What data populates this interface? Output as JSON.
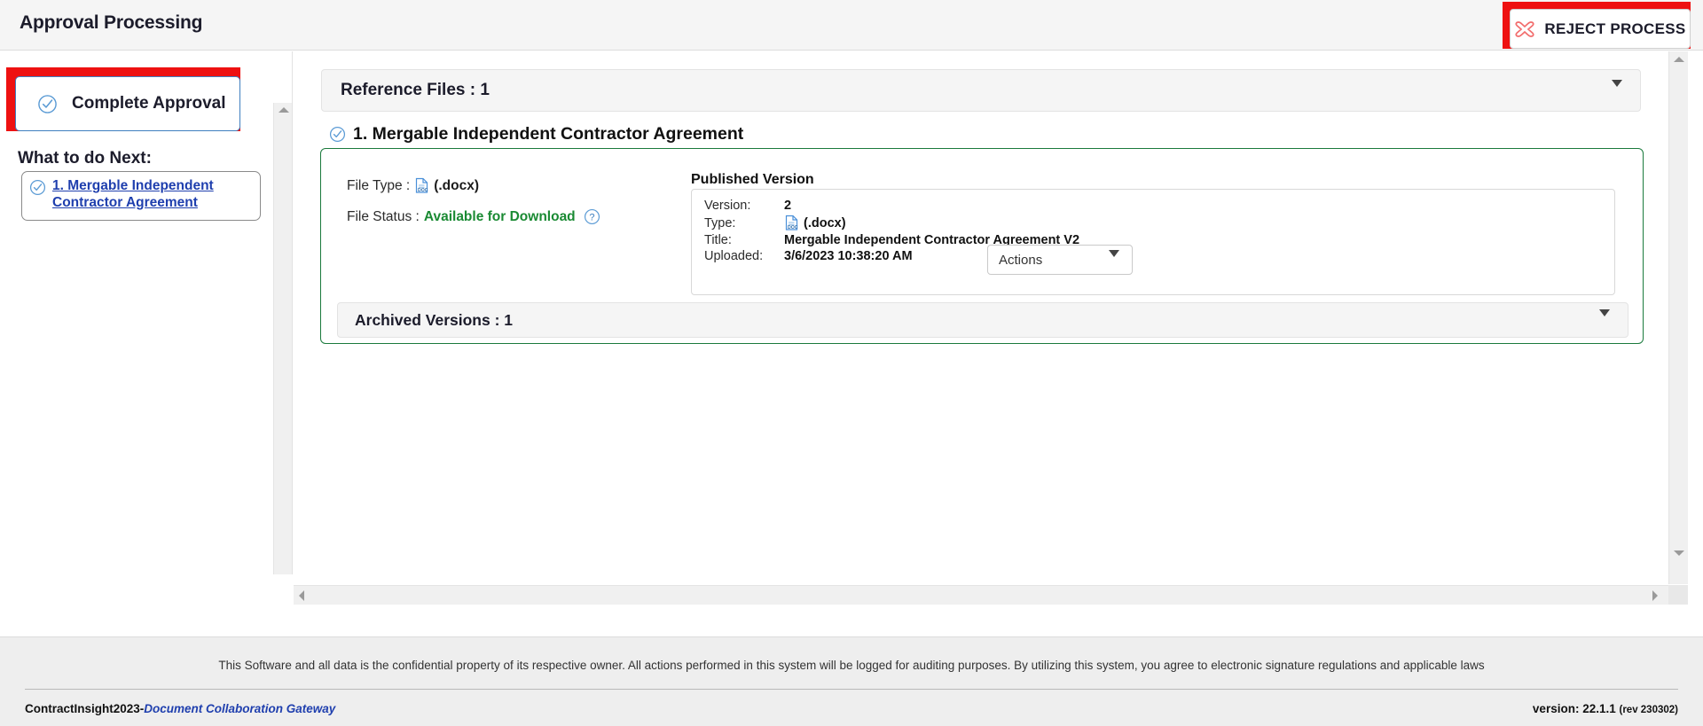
{
  "header": {
    "title": "Approval Processing",
    "reject_button": {
      "label": "REJECT PROCESS",
      "icon": "reject-x-icon",
      "highlight_color": "#ee1111"
    }
  },
  "left_panel": {
    "complete_approval": {
      "label": "Complete Approval",
      "icon": "check-circle-icon",
      "highlight_color": "#ee1111"
    },
    "what_to_do_next": {
      "title": "What to do Next:",
      "items": [
        {
          "icon": "check-circle-icon",
          "label": "1. Mergable Independent Contractor Agreement"
        }
      ]
    },
    "scrollbar": {
      "up_icon": "triangle-up-icon",
      "down_icon": "triangle-down-icon"
    }
  },
  "main": {
    "reference_files": {
      "label": "Reference Files : 1",
      "caret_icon": "chevron-down-icon"
    },
    "document": {
      "heading": "1. Mergable Independent Contractor Agreement",
      "heading_icon": "check-circle-icon",
      "border_color": "#1a7a3c",
      "file_type_label": "File Type :",
      "file_type_icon": "doc-file-icon",
      "file_type_value": "(.docx)",
      "file_status_label": "File Status :",
      "file_status_value": "Available for Download",
      "file_status_color": "#1a8a33",
      "help_icon": "question-circle-icon",
      "published_version": {
        "title": "Published Version",
        "rows": [
          {
            "key": "Version:",
            "value": "2"
          },
          {
            "key": "Type:",
            "value": "(.docx)",
            "icon": "doc-file-icon"
          },
          {
            "key": "Title:",
            "value": "Mergable Independent Contractor Agreement V2"
          },
          {
            "key": "Uploaded:",
            "value": "3/6/2023 10:38:20 AM"
          }
        ],
        "actions_select": {
          "value": "Actions",
          "caret_icon": "chevron-down-icon"
        }
      },
      "archived_versions": {
        "label": "Archived Versions : 1",
        "caret_icon": "chevron-down-icon"
      }
    },
    "scrollbars": {
      "v_up_icon": "triangle-up-icon",
      "v_down_icon": "triangle-down-icon",
      "h_left_icon": "triangle-left-icon",
      "h_right_icon": "triangle-right-icon"
    }
  },
  "footer": {
    "disclaimer": "This Software and all data is the confidential property of its respective owner. All actions performed in this system will be logged for auditing purposes. By utilizing this system, you agree to electronic signature regulations and applicable laws",
    "brand_name": "ContractInsight2023",
    "brand_dash": "-",
    "brand_subtitle": "Document Collaboration Gateway",
    "version_label": "version: 22.1.1",
    "revision_label": "(rev 230302)"
  }
}
